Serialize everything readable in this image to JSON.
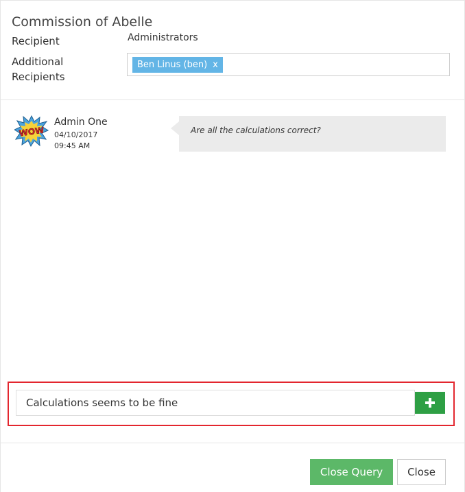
{
  "dialog": {
    "title": "Commission of Abelle"
  },
  "form": {
    "recipient_label": "Recipient",
    "recipient_value": "Administrators",
    "additional_label": "Additional Recipients",
    "additional_tags": [
      {
        "label": "Ben Linus (ben)",
        "remove": "x"
      }
    ]
  },
  "messages": [
    {
      "author": "Admin One",
      "date": "04/10/2017",
      "time": "09:45 AM",
      "avatar_icon": "wow-comic-icon",
      "avatar_text": "WOW",
      "text": "Are all the calculations correct?"
    }
  ],
  "reply": {
    "value": "Calculations seems to be fine",
    "add_icon": "plus-icon"
  },
  "footer": {
    "close_query_label": "Close Query",
    "close_label": "Close"
  },
  "colors": {
    "tag": "#63b5e6",
    "highlight": "#e3262e",
    "add_button": "#2e9f44",
    "primary_button": "#5cb868"
  }
}
